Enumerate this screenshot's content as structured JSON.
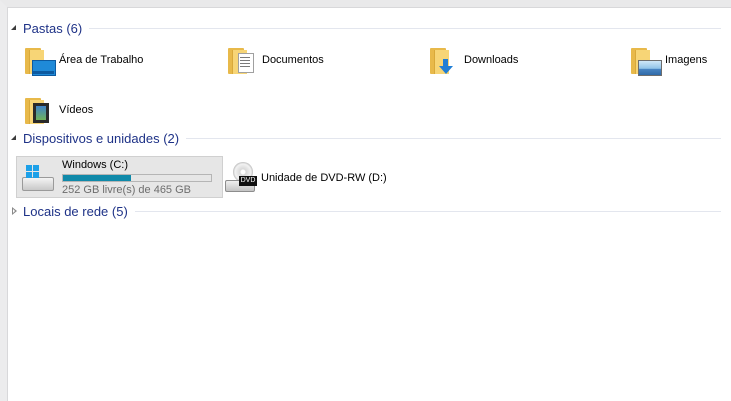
{
  "groups": {
    "folders": {
      "label": "Pastas (6)",
      "expanded": true
    },
    "devices": {
      "label": "Dispositivos e unidades (2)",
      "expanded": true
    },
    "network": {
      "label": "Locais de rede (5)",
      "expanded": false
    }
  },
  "folders": [
    {
      "label": "Área de Trabalho",
      "icon": "desktop-folder-icon"
    },
    {
      "label": "Documentos",
      "icon": "documents-folder-icon"
    },
    {
      "label": "Downloads",
      "icon": "downloads-folder-icon"
    },
    {
      "label": "Imagens",
      "icon": "pictures-folder-icon"
    },
    {
      "label": "Vídeos",
      "icon": "videos-folder-icon"
    }
  ],
  "drives": [
    {
      "label": "Windows (C:)",
      "free_text": "252 GB livre(s) de 465 GB",
      "used_fraction": 0.458,
      "icon": "windows-drive-icon",
      "bar_color": "#0f89a9"
    },
    {
      "label": "Unidade de DVD-RW (D:)",
      "icon": "dvd-drive-icon",
      "badge": "DVD"
    }
  ],
  "colors": {
    "group_header": "#1e3287",
    "folder_back": "#e8b94a",
    "folder_front": "#f7d576",
    "selection": "#e6e6e6"
  }
}
